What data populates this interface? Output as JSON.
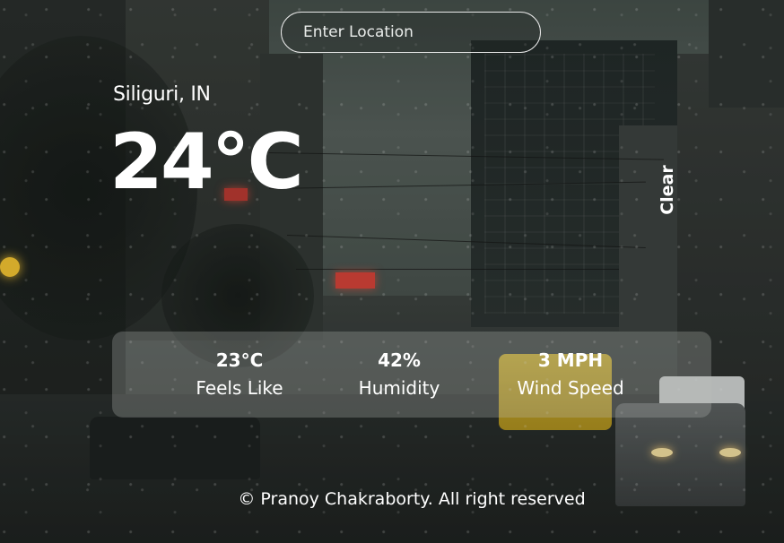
{
  "search": {
    "placeholder": "Enter Location",
    "value": ""
  },
  "weather": {
    "location": "Siliguri, IN",
    "temperature": "24°C",
    "condition": "Clear"
  },
  "details": {
    "feels_like": {
      "value": "23°C",
      "label": "Feels Like"
    },
    "humidity": {
      "value": "42%",
      "label": "Humidity"
    },
    "wind_speed": {
      "value": "3 MPH",
      "label": "Wind Speed"
    }
  },
  "footer": {
    "text": "© Pranoy Chakraborty. All right reserved"
  },
  "colors": {
    "text": "#ffffff",
    "card_background": "rgba(185,190,188,0.28)",
    "input_border": "#e8e8e8"
  },
  "background": {
    "description_icon": "rainy-city-street-background"
  }
}
